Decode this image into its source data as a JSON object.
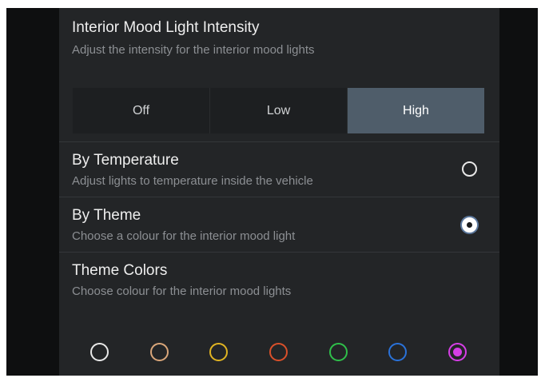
{
  "intensity": {
    "title": "Interior Mood Light Intensity",
    "subtitle": "Adjust the intensity for the interior mood lights",
    "options": [
      "Off",
      "Low",
      "High"
    ],
    "selected": "High"
  },
  "by_temperature": {
    "title": "By Temperature",
    "subtitle": "Adjust lights to temperature inside the vehicle",
    "selected": false
  },
  "by_theme": {
    "title": "By Theme",
    "subtitle": "Choose a colour for the interior mood light",
    "selected": true
  },
  "theme_colors": {
    "title": "Theme Colors",
    "subtitle": "Choose colour for the interior mood lights",
    "swatches": [
      {
        "color": "#e8e8e8",
        "selected": false
      },
      {
        "color": "#d9a67a",
        "selected": false
      },
      {
        "color": "#e0b422",
        "selected": false
      },
      {
        "color": "#d9502a",
        "selected": false
      },
      {
        "color": "#2fbf4a",
        "selected": false
      },
      {
        "color": "#2a72d9",
        "selected": false
      },
      {
        "color": "#d63ee6",
        "selected": true
      }
    ]
  },
  "colors": {
    "panel_bg": "#232527",
    "selected_segment": "#4f5d6a",
    "divider": "#34373a"
  }
}
